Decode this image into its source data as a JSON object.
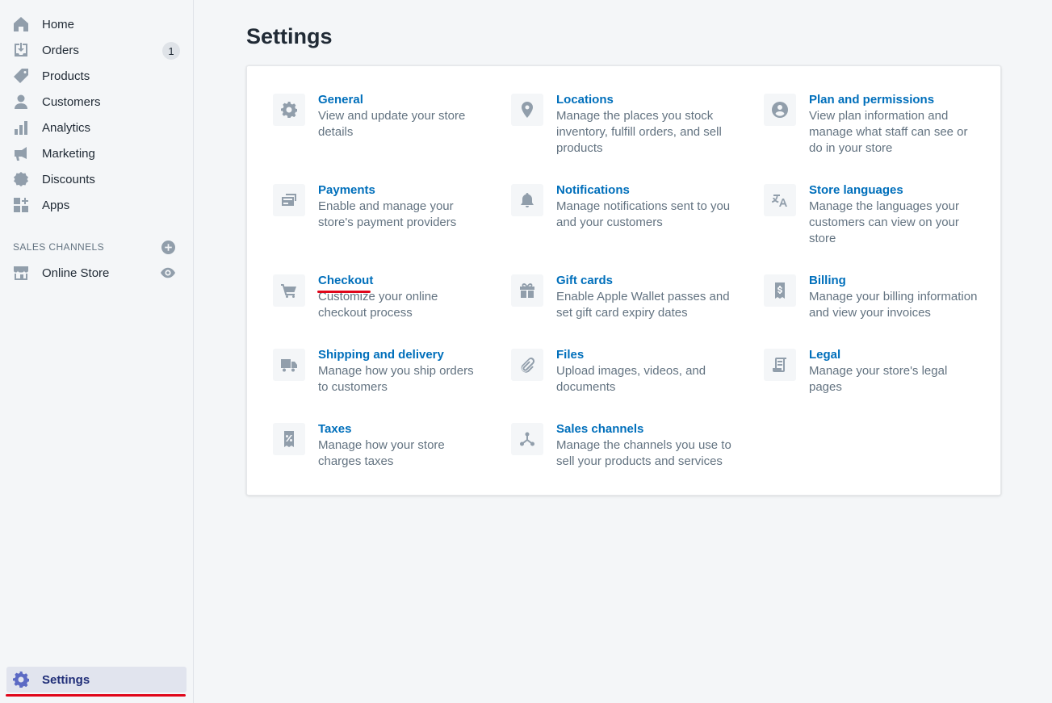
{
  "nav": {
    "items": [
      {
        "label": "Home",
        "icon": "home-icon"
      },
      {
        "label": "Orders",
        "icon": "orders-icon",
        "badge": "1"
      },
      {
        "label": "Products",
        "icon": "tag-icon"
      },
      {
        "label": "Customers",
        "icon": "person-icon"
      },
      {
        "label": "Analytics",
        "icon": "bar-chart-icon"
      },
      {
        "label": "Marketing",
        "icon": "megaphone-icon"
      },
      {
        "label": "Discounts",
        "icon": "discount-icon"
      },
      {
        "label": "Apps",
        "icon": "apps-icon"
      }
    ],
    "sales_channels_label": "SALES CHANNELS",
    "online_store_label": "Online Store",
    "settings_label": "Settings"
  },
  "page": {
    "title": "Settings"
  },
  "settings_tiles": [
    {
      "title": "General",
      "desc": "View and update your store details",
      "icon": "gear-icon"
    },
    {
      "title": "Locations",
      "desc": "Manage the places you stock inventory, fulfill orders, and sell products",
      "icon": "location-pin-icon"
    },
    {
      "title": "Plan and permissions",
      "desc": "View plan information and manage what staff can see or do in your store",
      "icon": "user-circle-icon"
    },
    {
      "title": "Payments",
      "desc": "Enable and manage your store's payment providers",
      "icon": "payment-card-icon"
    },
    {
      "title": "Notifications",
      "desc": "Manage notifications sent to you and your customers",
      "icon": "bell-icon"
    },
    {
      "title": "Store languages",
      "desc": "Manage the languages your customers can view on your store",
      "icon": "translate-icon"
    },
    {
      "title": "Checkout",
      "desc": "Customize your online checkout process",
      "icon": "cart-icon"
    },
    {
      "title": "Gift cards",
      "desc": "Enable Apple Wallet passes and set gift card expiry dates",
      "icon": "gift-icon"
    },
    {
      "title": "Billing",
      "desc": "Manage your billing information and view your invoices",
      "icon": "billing-receipt-icon"
    },
    {
      "title": "Shipping and delivery",
      "desc": "Manage how you ship orders to customers",
      "icon": "truck-icon"
    },
    {
      "title": "Files",
      "desc": "Upload images, videos, and documents",
      "icon": "paperclip-icon"
    },
    {
      "title": "Legal",
      "desc": "Manage your store's legal pages",
      "icon": "legal-document-icon"
    },
    {
      "title": "Taxes",
      "desc": "Manage how your store charges taxes",
      "icon": "tax-receipt-icon"
    },
    {
      "title": "Sales channels",
      "desc": "Manage the channels you use to sell your products and services",
      "icon": "sales-channels-icon"
    }
  ],
  "colors": {
    "link": "#006fbb",
    "sidebar_active_bg": "#e1e4ee",
    "annotation_red": "#e0061a"
  }
}
